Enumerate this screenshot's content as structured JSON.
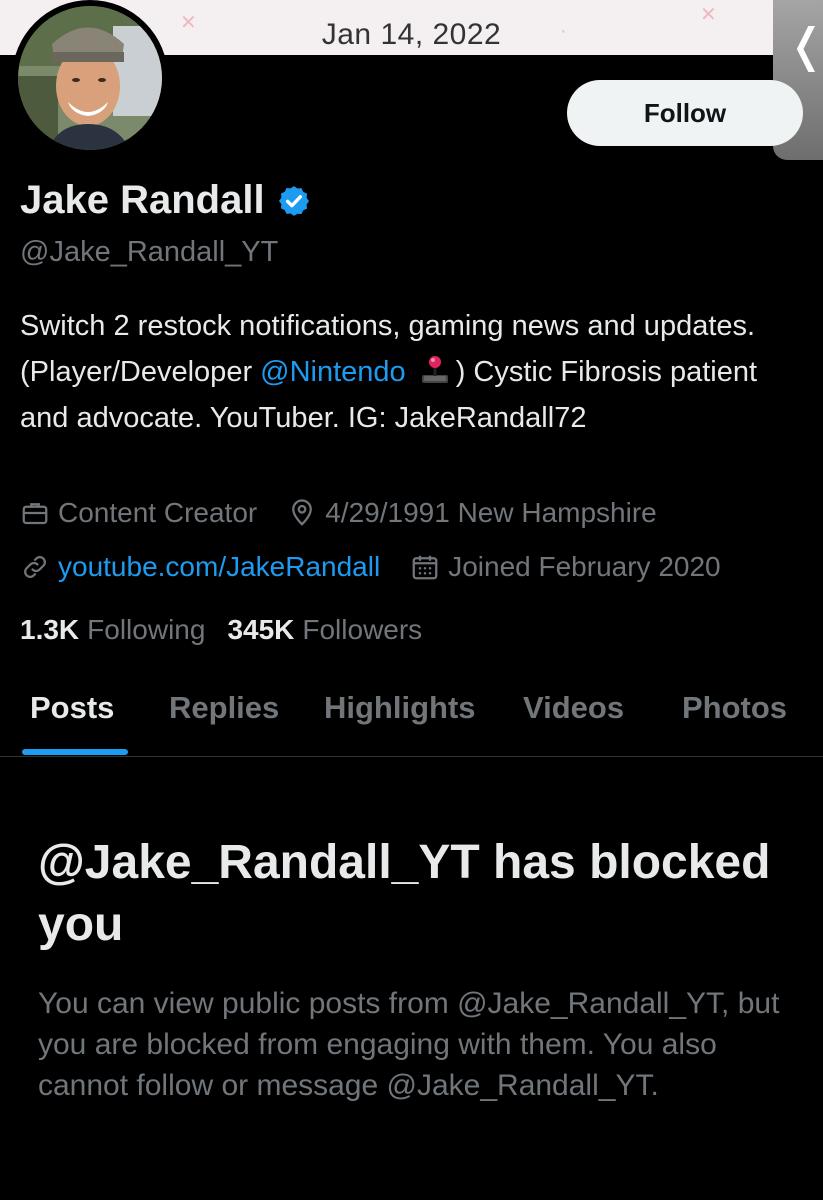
{
  "banner": {
    "date": "Jan 14, 2022"
  },
  "profile": {
    "name": "Jake Randall",
    "handle": "@Jake_Randall_YT",
    "follow_label": "Follow",
    "bio": {
      "line_part1": "Switch 2 restock notifications, gaming news and updates. (Player/Developer ",
      "mention": "@Nintendo",
      "line_part2": ") Cystic Fibrosis patient and advocate. YouTuber. IG: JakeRandall72"
    },
    "category": "Content Creator",
    "location": "4/29/1991 New Hampshire",
    "website": "youtube.com/JakeRandall",
    "joined": "Joined February 2020",
    "following_count": "1.3K",
    "following_label": "Following",
    "followers_count": "345K",
    "followers_label": "Followers"
  },
  "tabs": [
    "Posts",
    "Replies",
    "Highlights",
    "Videos",
    "Photos"
  ],
  "blocked": {
    "title": "@Jake_Randall_YT has blocked you",
    "body": "You can view public posts from @Jake_Randall_YT, but you are blocked from engaging with them. You also cannot follow or message @Jake_Randall_YT."
  },
  "icons": {
    "verified": "verified-badge-icon",
    "category": "briefcase-icon",
    "location": "location-pin-icon",
    "website": "link-icon",
    "joined": "calendar-icon",
    "back": "chevron-left-icon",
    "emoji": "joystick-icon"
  },
  "colors": {
    "background": "#000000",
    "accent": "#1d9bf0",
    "secondary_text": "#71767b",
    "primary_text": "#e7e9ea"
  }
}
